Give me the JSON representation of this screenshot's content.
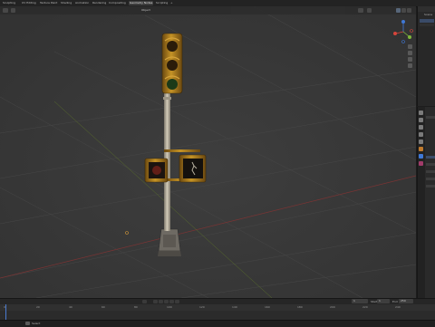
{
  "workspace_tabs": [
    "Sculpting",
    "UV Editing",
    "Texture Paint",
    "Shading",
    "Animation",
    "Rendering",
    "Compositing",
    "Geometry Nodes",
    "Scripting"
  ],
  "active_tab_index": 6,
  "viewport_header": {
    "mode": "Object",
    "shading": "Solid"
  },
  "timeline": {
    "ticks": [
      "0",
      "20",
      "40",
      "60",
      "80",
      "100",
      "120",
      "140",
      "160",
      "180",
      "200",
      "220",
      "240"
    ],
    "current_frame": "1",
    "start_label": "Start",
    "start_value": "1",
    "end_label": "End",
    "end_value": "250"
  },
  "outliner": {
    "label": "Scene"
  },
  "colors": {
    "viewport_bg": "#3b3b3b",
    "grid": "#4a4a4a",
    "x_axis": "#8e3a3a",
    "y_axis": "#6b8a2a",
    "brass": "#a8791f",
    "pole": "#b9b2a2",
    "gizmo_x": "#d6453b",
    "gizmo_y": "#7fb83a",
    "gizmo_z": "#3f78d6"
  },
  "status": {
    "left": "Select"
  }
}
